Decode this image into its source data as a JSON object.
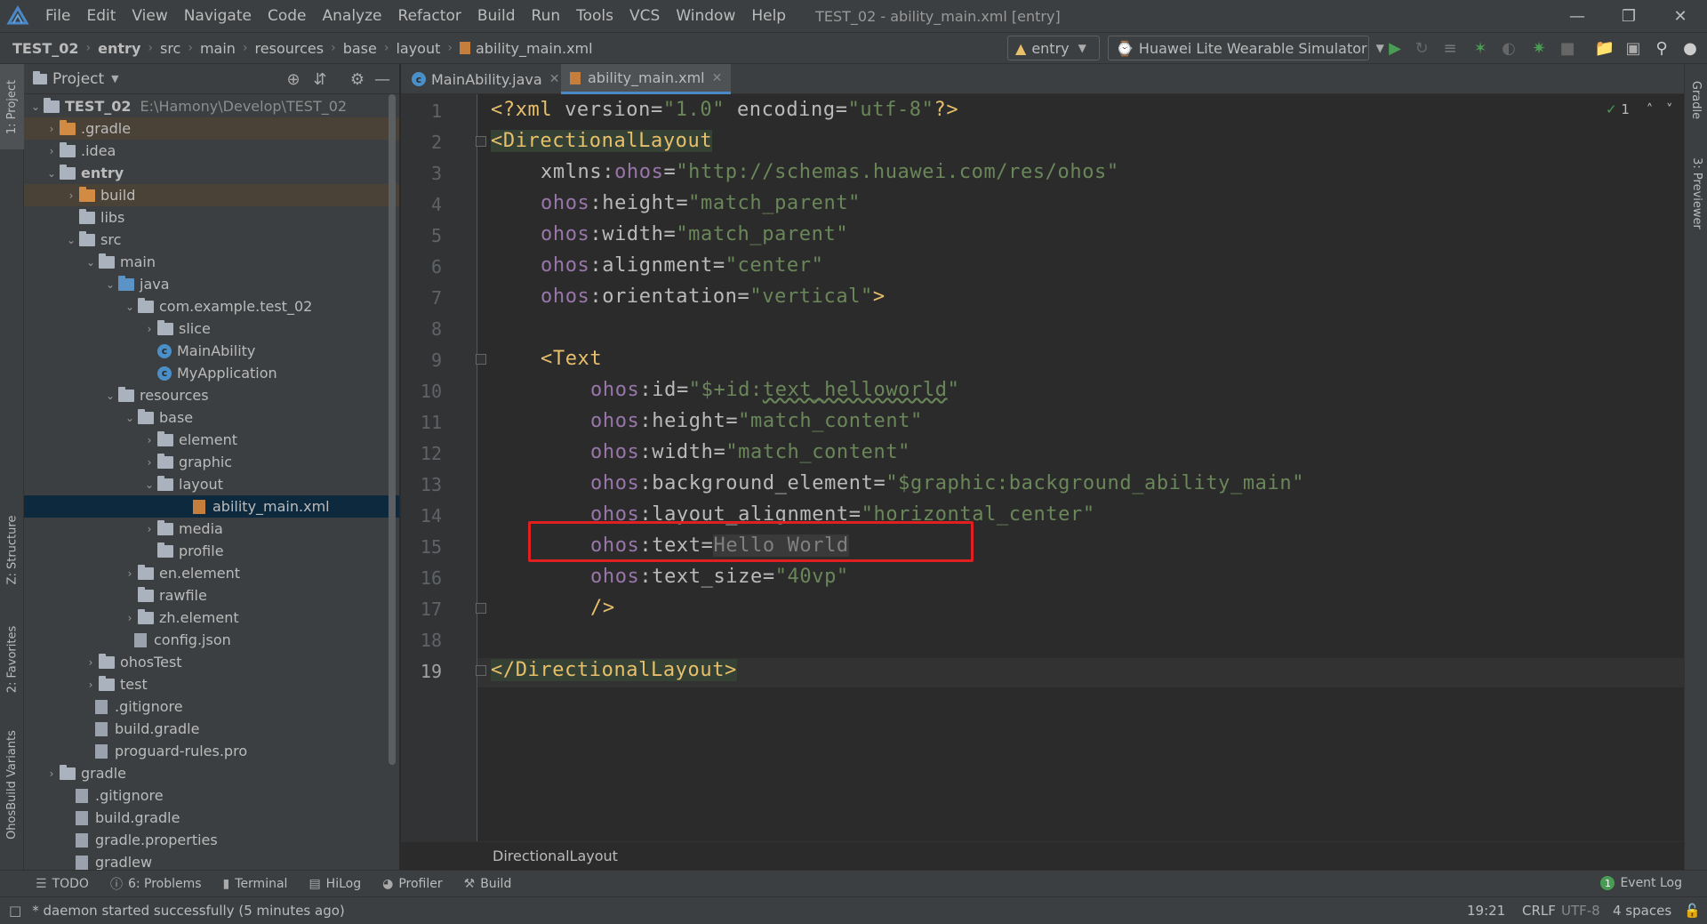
{
  "menubar": {
    "items": [
      "File",
      "Edit",
      "View",
      "Navigate",
      "Code",
      "Analyze",
      "Refactor",
      "Build",
      "Run",
      "Tools",
      "VCS",
      "Window",
      "Help"
    ],
    "window_title": "TEST_02 - ability_main.xml [entry]"
  },
  "navbar": {
    "breadcrumbs": [
      "TEST_02",
      "entry",
      "src",
      "main",
      "resources",
      "base",
      "layout",
      "ability_main.xml"
    ],
    "module_combo": "entry",
    "device_combo": "Huawei Lite Wearable Simulator"
  },
  "side_tabs": {
    "project": "1: Project",
    "structure": "Z: Structure",
    "favorites": "2: Favorites",
    "build_variants": "OhosBuild Variants",
    "gradle": "Gradle",
    "previewer": "3: Previewer"
  },
  "project_panel": {
    "title": "Project",
    "tree": [
      {
        "label": "TEST_02",
        "path": "E:\\Hamony\\Develop\\TEST_02",
        "bold": true
      },
      {
        "label": ".gradle"
      },
      {
        "label": ".idea"
      },
      {
        "label": "entry",
        "bold": true
      },
      {
        "label": "build"
      },
      {
        "label": "libs"
      },
      {
        "label": "src"
      },
      {
        "label": "main"
      },
      {
        "label": "java"
      },
      {
        "label": "com.example.test_02"
      },
      {
        "label": "slice"
      },
      {
        "label": "MainAbility"
      },
      {
        "label": "MyApplication"
      },
      {
        "label": "resources"
      },
      {
        "label": "base"
      },
      {
        "label": "element"
      },
      {
        "label": "graphic"
      },
      {
        "label": "layout"
      },
      {
        "label": "ability_main.xml"
      },
      {
        "label": "media"
      },
      {
        "label": "profile"
      },
      {
        "label": "en.element"
      },
      {
        "label": "rawfile"
      },
      {
        "label": "zh.element"
      },
      {
        "label": "config.json"
      },
      {
        "label": "ohosTest"
      },
      {
        "label": "test"
      },
      {
        "label": ".gitignore"
      },
      {
        "label": "build.gradle"
      },
      {
        "label": "proguard-rules.pro"
      },
      {
        "label": "gradle"
      },
      {
        "label": ".gitignore"
      },
      {
        "label": "build.gradle"
      },
      {
        "label": "gradle.properties"
      },
      {
        "label": "gradlew"
      }
    ]
  },
  "editor_tabs": [
    {
      "label": "MainAbility.java",
      "active": false
    },
    {
      "label": "ability_main.xml",
      "active": true
    }
  ],
  "editor": {
    "line_numbers": [
      "1",
      "2",
      "3",
      "4",
      "5",
      "6",
      "7",
      "8",
      "9",
      "10",
      "11",
      "12",
      "13",
      "14",
      "15",
      "16",
      "17",
      "18",
      "19"
    ],
    "inspection_count": "1",
    "lines": {
      "l1": {
        "a": "<?xml ",
        "b": "version",
        "c": "=",
        "d": "\"1.0\"",
        "e": " encoding",
        "f": "=",
        "g": "\"utf-8\"",
        "h": "?>"
      },
      "l2": "<DirectionalLayout",
      "l3": {
        "attr": "xmlns:",
        "ns": "ohos",
        "eq": "=",
        "val": "\"http://schemas.huawei.com/res/ohos\""
      },
      "l4": {
        "ns": "ohos",
        "attr": ":height",
        "eq": "=",
        "val": "\"match_parent\""
      },
      "l5": {
        "ns": "ohos",
        "attr": ":width",
        "eq": "=",
        "val": "\"match_parent\""
      },
      "l6": {
        "ns": "ohos",
        "attr": ":alignment",
        "eq": "=",
        "val": "\"center\""
      },
      "l7": {
        "ns": "ohos",
        "attr": ":orientation",
        "eq": "=",
        "val": "\"vertical\"",
        "end": ">"
      },
      "l9": "<Text",
      "l10": {
        "ns": "ohos",
        "attr": ":id",
        "eq": "=",
        "val1": "\"$+id:",
        "val2": "text_helloworld",
        "val3": "\""
      },
      "l11": {
        "ns": "ohos",
        "attr": ":height",
        "eq": "=",
        "val": "\"match_content\""
      },
      "l12": {
        "ns": "ohos",
        "attr": ":width",
        "eq": "=",
        "val": "\"match_content\""
      },
      "l13": {
        "ns": "ohos",
        "attr": ":background_element",
        "eq": "=",
        "val": "\"$graphic:background_ability_main\""
      },
      "l14": {
        "ns": "ohos",
        "attr": ":layout_alignment",
        "eq": "=",
        "val": "\"horizontal_center\""
      },
      "l15": {
        "ns": "ohos",
        "attr": ":text",
        "eq": "=",
        "val": "Hello World"
      },
      "l16": {
        "ns": "ohos",
        "attr": ":text_size",
        "eq": "=",
        "val": "\"40vp\""
      },
      "l17": "/>",
      "l19": "</DirectionalLayout>"
    },
    "breadcrumb": "DirectionalLayout"
  },
  "tool_windows": [
    {
      "label": "TODO"
    },
    {
      "label": "6: Problems"
    },
    {
      "label": "Terminal"
    },
    {
      "label": "HiLog"
    },
    {
      "label": "Profiler"
    },
    {
      "label": "Build"
    }
  ],
  "event_log": {
    "label": "Event Log",
    "count": "1"
  },
  "status": {
    "message": "* daemon started successfully (5 minutes ago)",
    "position": "19:21",
    "line_sep": "CRLF",
    "encoding": "UTF-8",
    "indent": "4 spaces"
  },
  "colors": {
    "accent": "#4a88c7",
    "highlight_box": "#e02020",
    "string": "#6a8759",
    "tag": "#e8bf6a",
    "namespace": "#9876aa"
  }
}
